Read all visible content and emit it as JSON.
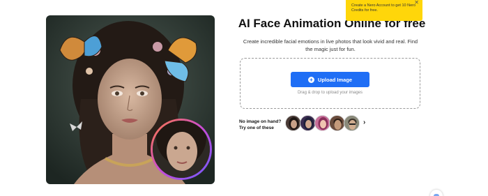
{
  "hero": {
    "image": "ai-portrait-woman-butterflies",
    "inset": "animated-portrait-thumbnail"
  },
  "main": {
    "title": "AI Face Animation Online for free",
    "subtitle": "Create incredible facial emotions in live photos that look vivid and real. Find the magic just for fun.",
    "upload_label": "Upload Image",
    "drop_hint": "Drag & drop to upload your images"
  },
  "samples": {
    "label": "No image on hand? Try one of these",
    "items": [
      "sample-woman-dark-hair",
      "sample-woman-colorful",
      "sample-woman-pink",
      "sample-man-portrait",
      "sample-man-glasses"
    ]
  },
  "toast": {
    "message": "Create a Nero Account to get 10 Nero Credits for free.",
    "close": "✕"
  },
  "colors": {
    "accent": "#1f6ef5",
    "toast": "#ffd60a"
  }
}
